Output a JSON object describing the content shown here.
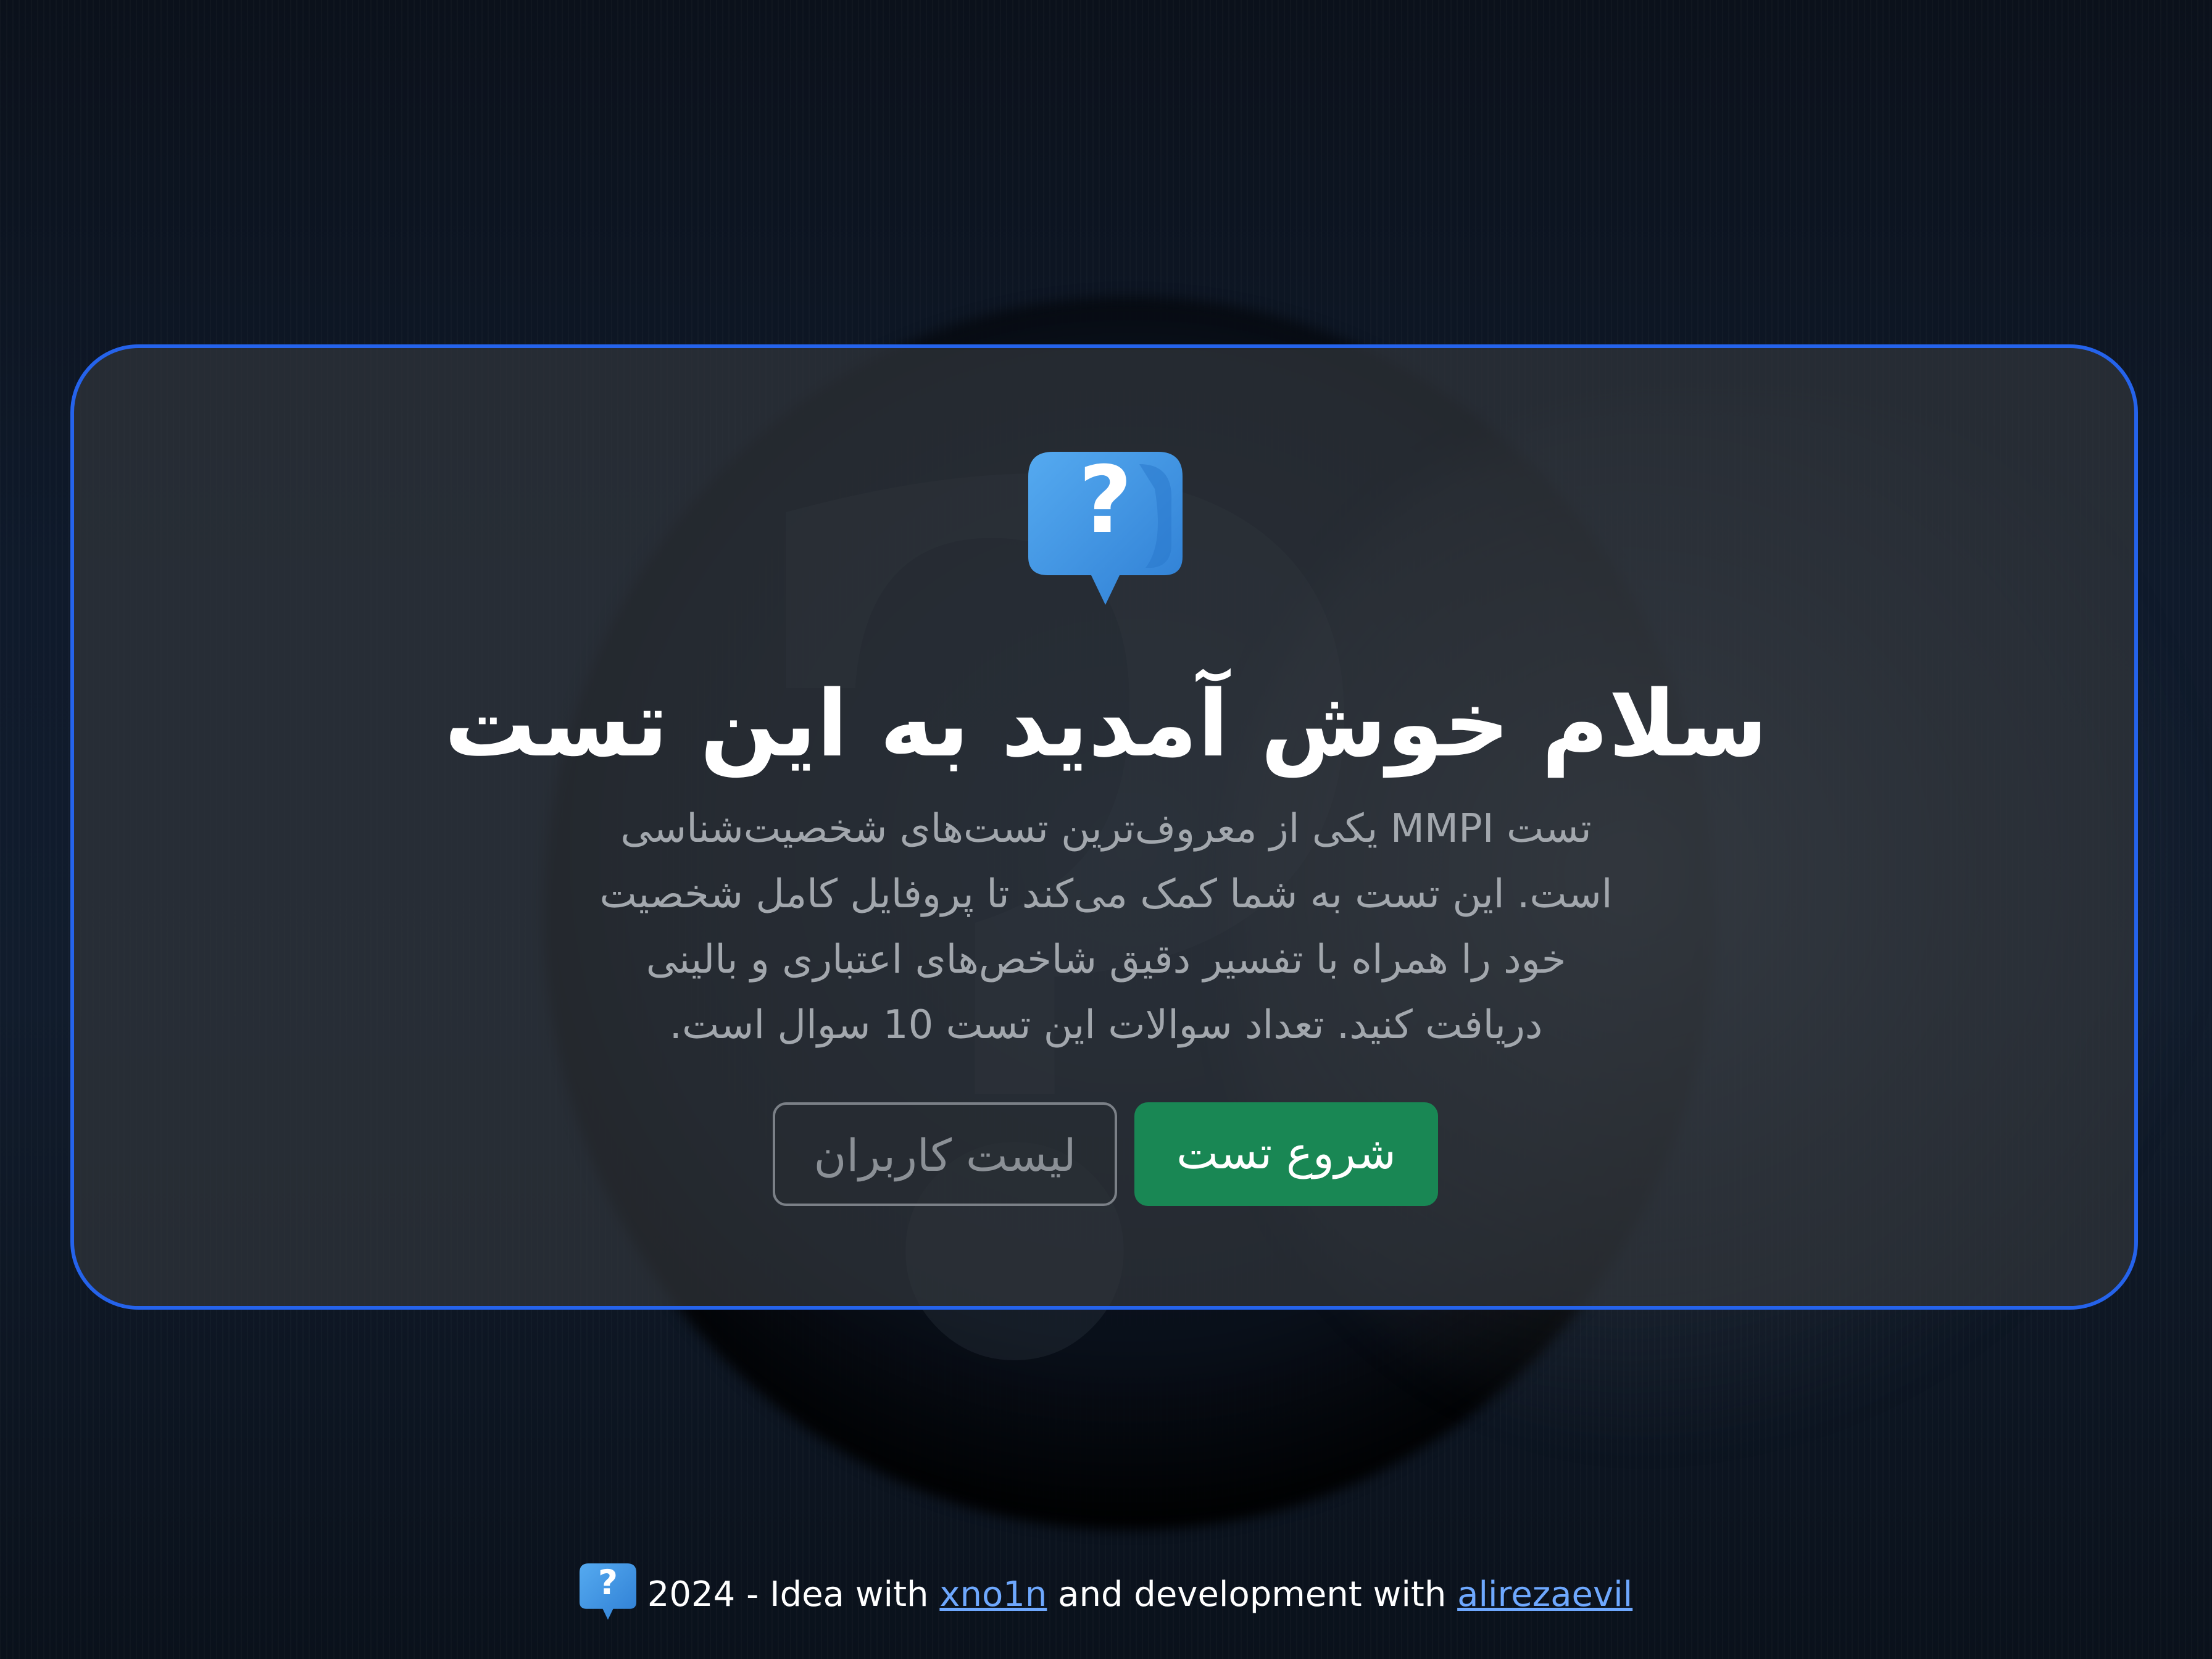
{
  "main": {
    "title": "سلام خوش آمدید به این تست",
    "description": "تست MMPI یکی از معروف‌ترین تست‌های شخصیت‌شناسی است. این تست به شما کمک می‌کند تا پروفایل کامل شخصیت خود را همراه با تفسیر دقیق شاخص‌های اعتباری و بالینی دریافت کنید. تعداد سوالات این تست 10 سوال است.",
    "users_button": "لیست کاربران",
    "start_button": "شروع تست"
  },
  "footer": {
    "prefix": "2024 - Idea with ",
    "link1": "xno1n",
    "middle": " and development with ",
    "link2": "alirezaevil"
  },
  "colors": {
    "card_border": "#2563eb",
    "start_button_bg": "#198754",
    "link": "#6ea8fe",
    "logo_blue": "#3a92e6"
  },
  "icons": {
    "logo": "question-bubble-icon",
    "footer_logo": "question-bubble-icon"
  }
}
